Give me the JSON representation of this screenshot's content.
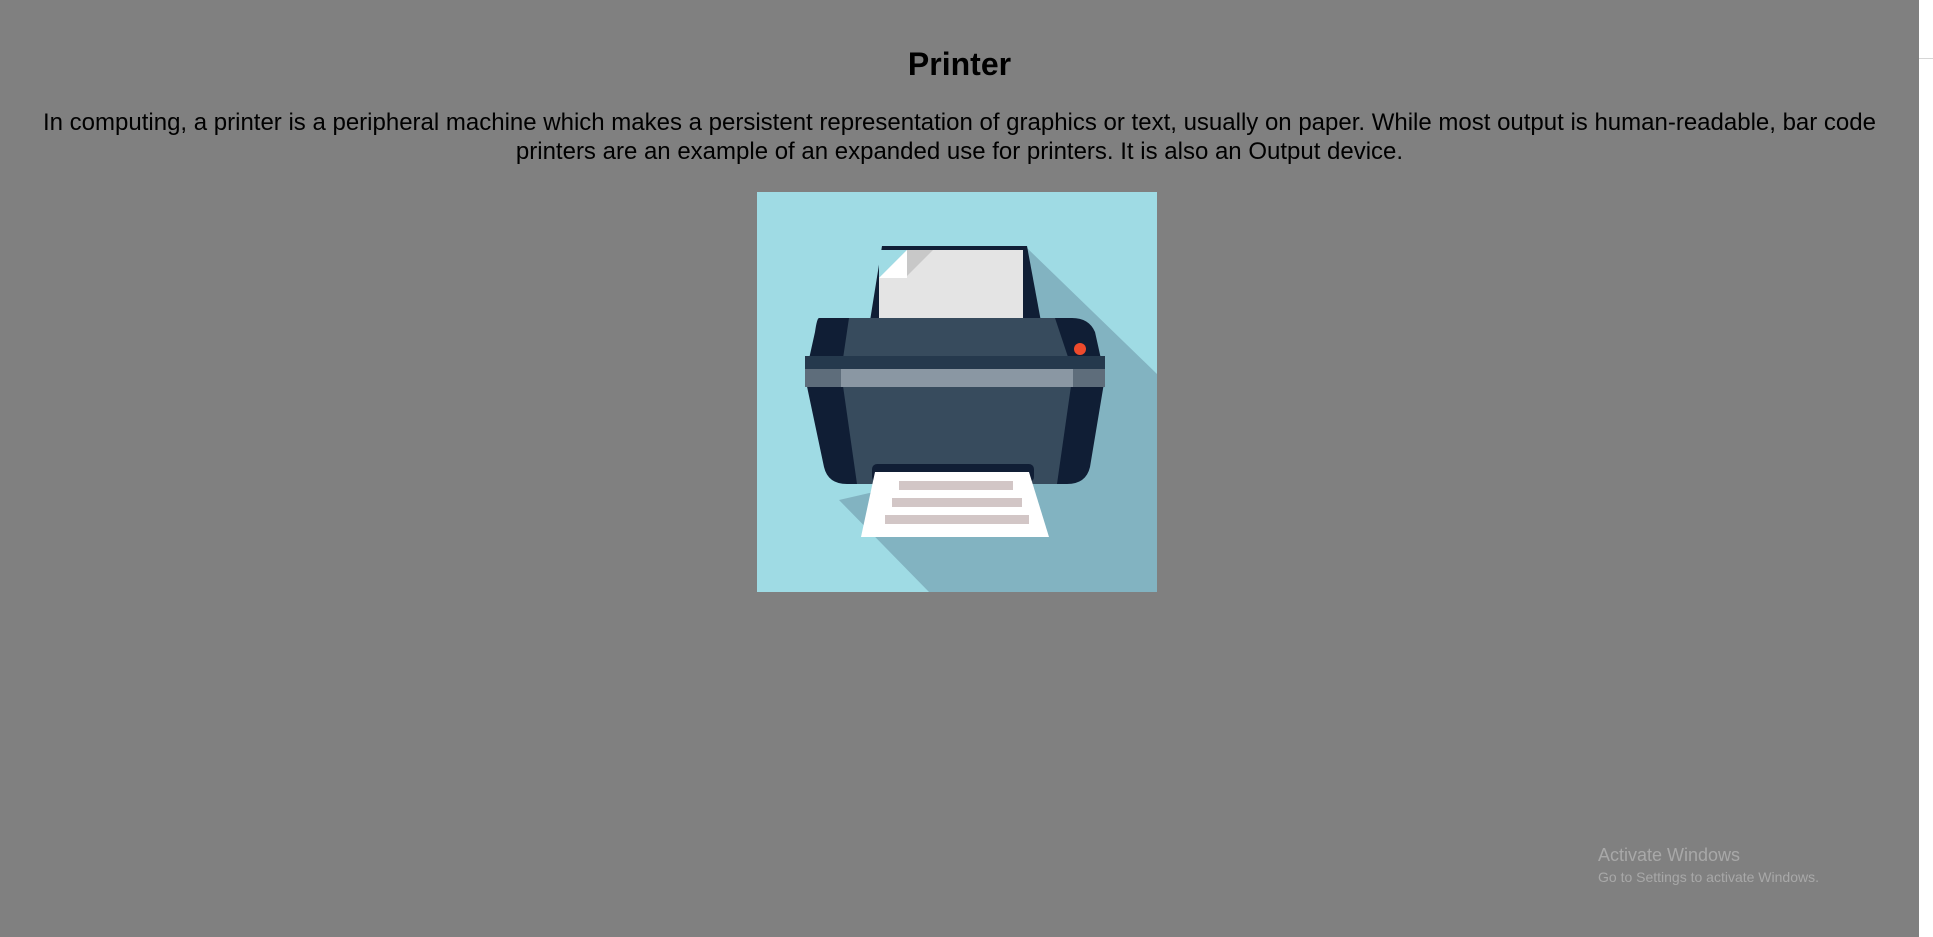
{
  "page": {
    "title": "Printer",
    "description": "In computing, a printer is a peripheral machine which makes a persistent representation of graphics or text, usually on paper. While most output is human-readable, bar code printers are an example of an expanded use for printers. It is also an Output device."
  },
  "image": {
    "subject": "printer-icon",
    "colors": {
      "background": "#9fdbe4",
      "shadow": "#82b3c1",
      "body_dark": "#101e35",
      "body_main": "#374b5d",
      "stripe": "#8a97a3",
      "paper": "#e4e4e4",
      "output_paper": "#ffffff",
      "output_lines": "#d2c6c6",
      "indicator_light": "#ee4a2c"
    }
  },
  "watermark": {
    "title": "Activate Windows",
    "subtitle": "Go to Settings to activate Windows."
  },
  "colors": {
    "page_background": "#808080",
    "text": "#000000",
    "watermark_text": "#a8a8a8"
  }
}
